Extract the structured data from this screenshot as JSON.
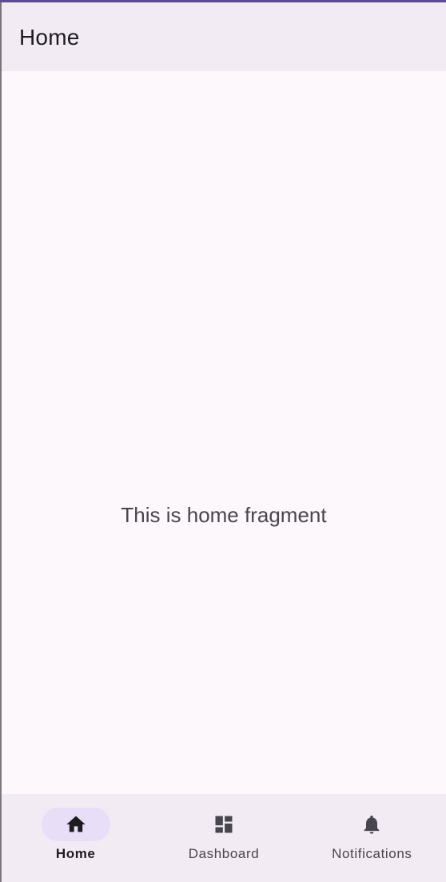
{
  "app_bar": {
    "title": "Home"
  },
  "content": {
    "text": "This is home fragment"
  },
  "bottom_nav": {
    "items": [
      {
        "label": "Home",
        "icon": "home-icon",
        "active": true
      },
      {
        "label": "Dashboard",
        "icon": "dashboard-icon",
        "active": false
      },
      {
        "label": "Notifications",
        "icon": "notifications-icon",
        "active": false
      }
    ]
  },
  "colors": {
    "accent": "#5b4a9e",
    "surface": "#f2ebf3",
    "background": "#fdf8fb",
    "indicator": "#e8def8",
    "text_primary": "#1d1b20",
    "text_secondary": "#49454f"
  }
}
